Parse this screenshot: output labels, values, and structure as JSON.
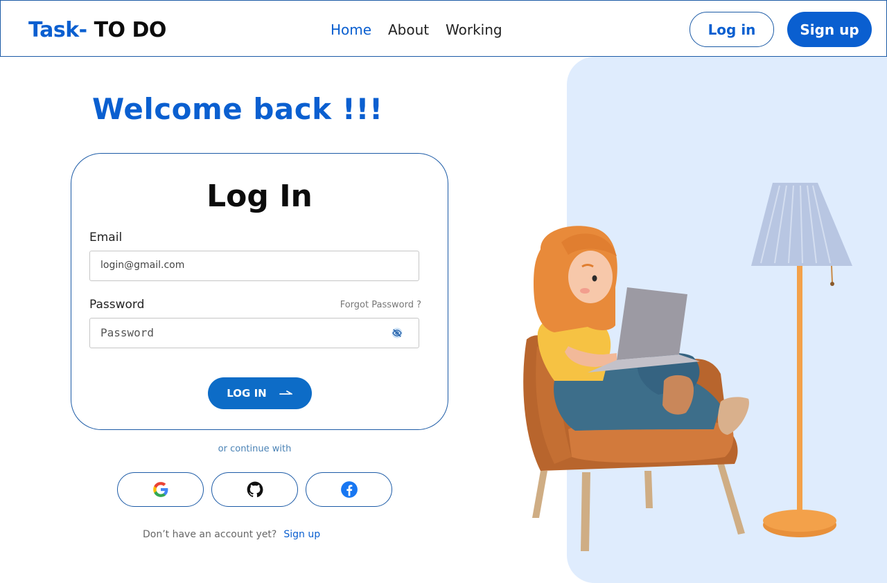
{
  "header": {
    "logo_part1": "Task-",
    "logo_part2": "TO DO",
    "nav": [
      {
        "label": "Home",
        "active": true
      },
      {
        "label": "About",
        "active": false
      },
      {
        "label": "Working",
        "active": false
      }
    ],
    "login_button": "Log in",
    "signup_button": "Sign up"
  },
  "welcome": "Welcome back !!!",
  "login_card": {
    "title": "Log In",
    "email_label": "Email",
    "email_value": "login@gmail.com",
    "password_label": "Password",
    "forgot_password": "Forgot Password ?",
    "password_placeholder": "Password",
    "submit_label": "LOG IN"
  },
  "continue_with": "or continue with",
  "social": [
    {
      "name": "google",
      "icon": "google-icon"
    },
    {
      "name": "github",
      "icon": "github-icon"
    },
    {
      "name": "facebook",
      "icon": "facebook-icon"
    }
  ],
  "signup_prompt": {
    "text": "Don’t have an account yet?",
    "link": "Sign up"
  },
  "colors": {
    "brand": "#0a5fd0",
    "panel_bg": "#dfecfd",
    "button_bg": "#0d6cc7"
  }
}
